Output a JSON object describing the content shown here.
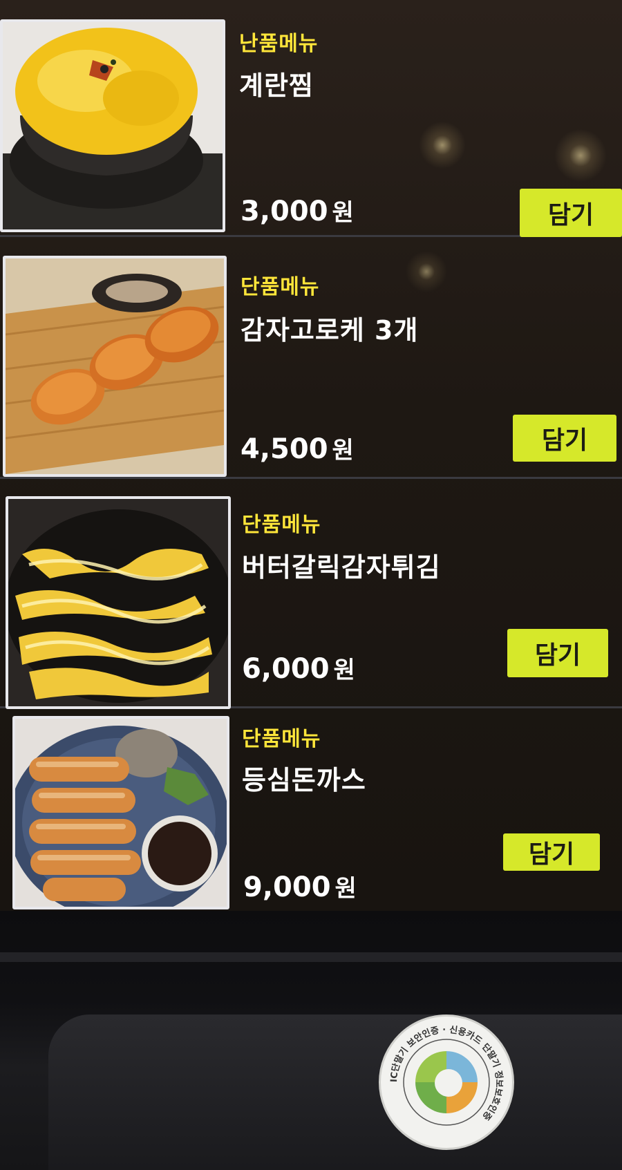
{
  "menu": [
    {
      "category": "난품메뉴",
      "name": "계란찜",
      "price": "3,000",
      "currency": "원",
      "add_label": "담기"
    },
    {
      "category": "단품메뉴",
      "name": "감자고로케 3개",
      "price": "4,500",
      "currency": "원",
      "add_label": "담기"
    },
    {
      "category": "단품메뉴",
      "name": "버터갈릭감자튀김",
      "price": "6,000",
      "currency": "원",
      "add_label": "담기"
    },
    {
      "category": "단품메뉴",
      "name": "등심돈까스",
      "price": "9,000",
      "currency": "원",
      "add_label": "담기"
    }
  ],
  "sticker": {
    "text": "IC단말기 보안인증 · 신용카드 단말기 정보보호인증"
  },
  "colors": {
    "category_yellow": "#ffe63a",
    "button_lime": "#d6e82a",
    "card_border": "#e8e8ec"
  }
}
